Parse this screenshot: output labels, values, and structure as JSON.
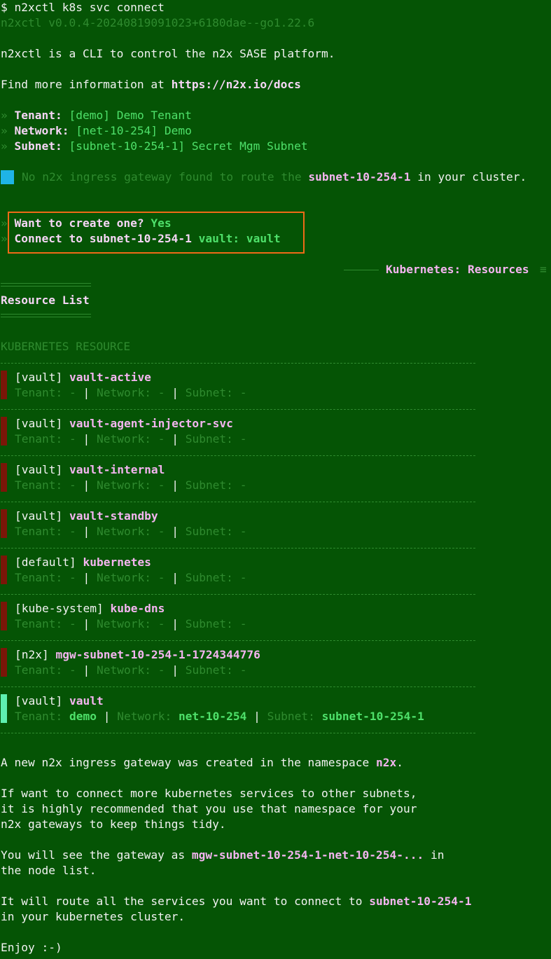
{
  "prompt": {
    "symbol": "$",
    "command": "n2xctl k8s svc connect"
  },
  "version": "n2xctl v0.0.4-20240819091023+6180dae--go1.22.6",
  "intro": "n2xctl is a CLI to control the n2x SASE platform.",
  "docs": {
    "prefix": "Find more information at ",
    "url": "https://n2x.io/docs"
  },
  "bullet": "»",
  "selection": {
    "tenant_label": "Tenant:",
    "tenant_value": "[demo] Demo Tenant",
    "network_label": "Network:",
    "network_value": "[net-10-254] Demo",
    "subnet_label": "Subnet:",
    "subnet_value": "[subnet-10-254-1] Secret Mgm Subnet"
  },
  "notice": {
    "prefix": "No n2x ingress gateway found to route the ",
    "subnet": "subnet-10-254-1",
    "suffix": " in your cluster."
  },
  "questions": {
    "create_q": "Want to create one?",
    "create_a": "Yes",
    "connect_q": "Connect to subnet-10-254-1",
    "connect_a": "vault: vault"
  },
  "section": {
    "title": "Kubernetes: Resources",
    "icon": "menu-icon"
  },
  "list": {
    "title": "Resource List",
    "header": "KUBERNETES RESOURCE",
    "tenant_label": "Tenant:",
    "network_label": "Network:",
    "subnet_label": "Subnet:",
    "pipe": "|",
    "items": [
      {
        "ns": "[vault]",
        "name": "vault-active",
        "tenant": "-",
        "network": "-",
        "subnet": "-"
      },
      {
        "ns": "[vault]",
        "name": "vault-agent-injector-svc",
        "tenant": "-",
        "network": "-",
        "subnet": "-"
      },
      {
        "ns": "[vault]",
        "name": "vault-internal",
        "tenant": "-",
        "network": "-",
        "subnet": "-"
      },
      {
        "ns": "[vault]",
        "name": "vault-standby",
        "tenant": "-",
        "network": "-",
        "subnet": "-"
      },
      {
        "ns": "[default]",
        "name": "kubernetes",
        "tenant": "-",
        "network": "-",
        "subnet": "-"
      },
      {
        "ns": "[kube-system]",
        "name": "kube-dns",
        "tenant": "-",
        "network": "-",
        "subnet": "-"
      },
      {
        "ns": "[n2x]",
        "name": "mgw-subnet-10-254-1-1724344776",
        "tenant": "-",
        "network": "-",
        "subnet": "-"
      },
      {
        "ns": "[vault]",
        "name": "vault",
        "tenant": "demo",
        "network": "net-10-254",
        "subnet": "subnet-10-254-1"
      }
    ]
  },
  "outro": {
    "line1_prefix": "A new n2x ingress gateway was created in the namespace ",
    "line1_ns": "n2x",
    "line1_suffix": ".",
    "line2": "If want to connect more kubernetes services to other subnets,",
    "line3": "it is highly recommended that you use that namespace for your",
    "line4": "n2x gateways to keep things tidy.",
    "line5_prefix": "You will see the gateway as ",
    "line5_gw": "mgw-subnet-10-254-1-net-10-254-...",
    "line5_suffix": " in",
    "line6": "the node list.",
    "line7_prefix": "It will route all the services you want to connect to ",
    "line7_subnet": "subnet-10-254-1",
    "line8": "in your kubernetes cluster.",
    "line9": "Enjoy :-)"
  }
}
